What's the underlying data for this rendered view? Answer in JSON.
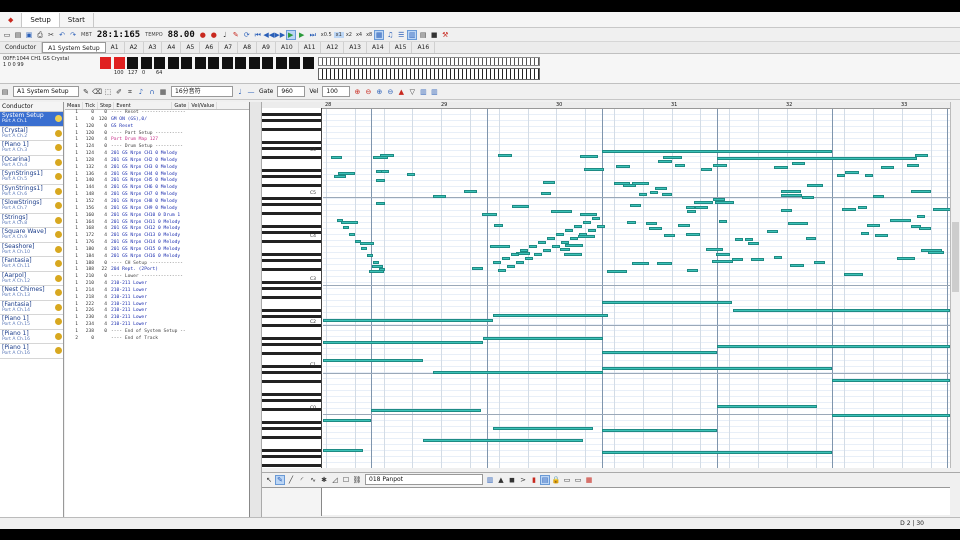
{
  "app_tabs": [
    "Setup",
    "Start"
  ],
  "transport": {
    "position": "28:1:165",
    "tempo": "88.00",
    "pos_caption": "MBT",
    "tempo_caption": "TEMPO"
  },
  "zoom_buttons": [
    "x0.5",
    "x1",
    "x2",
    "x4",
    "x8"
  ],
  "track_tabs": [
    "Conductor",
    "A1 System Setup",
    "A1",
    "A2",
    "A3",
    "A4",
    "A5",
    "A6",
    "A7",
    "A8",
    "A9",
    "A10",
    "A11",
    "A12",
    "A13",
    "A14",
    "A15",
    "A16"
  ],
  "device_info": {
    "line1": "00FF:1044 CH1 GS Crystal",
    "line2": "1    0    0     99"
  },
  "meter": {
    "values": [
      "100",
      "127",
      "0",
      "64"
    ]
  },
  "toolbar2": {
    "track_label": "A1 System Setup",
    "style_combo": "16分音符",
    "gate_label": "Gate",
    "gate_value": "960",
    "vel_label": "Vel",
    "vel_value": "100"
  },
  "tracklist": {
    "header": "Conductor",
    "tracks": [
      {
        "name": "System Setup",
        "sub": "Port A Ch.1"
      },
      {
        "name": "[Crystal]",
        "sub": "Port A Ch.2"
      },
      {
        "name": "[Piano 1]",
        "sub": "Port A Ch.3"
      },
      {
        "name": "[Ocarina]",
        "sub": "Port A Ch.4"
      },
      {
        "name": "[SynStrings1]",
        "sub": "Port A Ch.5"
      },
      {
        "name": "[SynStrings1]",
        "sub": "Port A Ch.6"
      },
      {
        "name": "[SlowStrings]",
        "sub": "Port A Ch.7"
      },
      {
        "name": "[Strings]",
        "sub": "Port A Ch.8"
      },
      {
        "name": "[Square Wave]",
        "sub": "Port A Ch.9"
      },
      {
        "name": "[Seashore]",
        "sub": "Port A Ch.10"
      },
      {
        "name": "[Fantasia]",
        "sub": "Port A Ch.11"
      },
      {
        "name": "[Aarpol]",
        "sub": "Port A Ch.12"
      },
      {
        "name": "[Nest Chimes]",
        "sub": "Port A Ch.13"
      },
      {
        "name": "[Fantasia]",
        "sub": "Port A Ch.14"
      },
      {
        "name": "[Piano 1]",
        "sub": "Port A Ch.15"
      },
      {
        "name": "[Piano 1]",
        "sub": "Port A Ch.16"
      },
      {
        "name": "[Piano 1]",
        "sub": "Port A Ch.16"
      }
    ]
  },
  "eventlist": {
    "columns": [
      "Meas",
      "Tick",
      "Step",
      "Event",
      "Gate",
      "Vel/Value"
    ],
    "rows": [
      {
        "m": "1",
        "t": "0",
        "s": "0",
        "e": "---- Reset ----------------",
        "k": "sep"
      },
      {
        "m": "1",
        "t": "0",
        "s": "120",
        "e": "GM ON (GS),0/",
        "k": ""
      },
      {
        "m": "1",
        "t": "120",
        "s": "0",
        "e": "GS Reset",
        "k": ""
      },
      {
        "m": "1",
        "t": "120",
        "s": "0",
        "e": "---- Part Setup ----------",
        "k": "sep"
      },
      {
        "m": "1",
        "t": "120",
        "s": "4",
        "e": "Part Drum Map          127",
        "k": "pink"
      },
      {
        "m": "1",
        "t": "124",
        "s": "0",
        "e": "---- Drum Setup ----------",
        "k": "sep"
      },
      {
        "m": "1",
        "t": "124",
        "s": "4",
        "e": "201 GS Nrpn CH1 0  Melody",
        "k": ""
      },
      {
        "m": "1",
        "t": "128",
        "s": "4",
        "e": "201 GS Nrpn CH2 0  Melody",
        "k": ""
      },
      {
        "m": "1",
        "t": "132",
        "s": "4",
        "e": "201 GS Nrpn CH3 0  Melody",
        "k": ""
      },
      {
        "m": "1",
        "t": "136",
        "s": "4",
        "e": "201 GS Nrpn CH4 0  Melody",
        "k": ""
      },
      {
        "m": "1",
        "t": "140",
        "s": "4",
        "e": "201 GS Nrpn CH5 0  Melody",
        "k": ""
      },
      {
        "m": "1",
        "t": "144",
        "s": "4",
        "e": "201 GS Nrpn CH6 0  Melody",
        "k": ""
      },
      {
        "m": "1",
        "t": "148",
        "s": "4",
        "e": "201 GS Nrpn CH7 0  Melody",
        "k": ""
      },
      {
        "m": "1",
        "t": "152",
        "s": "4",
        "e": "201 GS Nrpn CH8 0  Melody",
        "k": ""
      },
      {
        "m": "1",
        "t": "156",
        "s": "4",
        "e": "201 GS Nrpn CH9 0  Melody",
        "k": ""
      },
      {
        "m": "1",
        "t": "160",
        "s": "4",
        "e": "201 GS Nrpn CH10 0 Drum 1",
        "k": ""
      },
      {
        "m": "1",
        "t": "164",
        "s": "4",
        "e": "201 GS Nrpn CH11 0 Melody",
        "k": ""
      },
      {
        "m": "1",
        "t": "168",
        "s": "4",
        "e": "201 GS Nrpn CH12 0 Melody",
        "k": ""
      },
      {
        "m": "1",
        "t": "172",
        "s": "4",
        "e": "201 GS Nrpn CH13 0 Melody",
        "k": ""
      },
      {
        "m": "1",
        "t": "176",
        "s": "4",
        "e": "201 GS Nrpn CH14 0 Melody",
        "k": ""
      },
      {
        "m": "1",
        "t": "180",
        "s": "4",
        "e": "201 GS Nrpn CH15 0 Melody",
        "k": ""
      },
      {
        "m": "1",
        "t": "184",
        "s": "4",
        "e": "201 GS Nrpn CH16 0 Melody",
        "k": ""
      },
      {
        "m": "1",
        "t": "188",
        "s": "0",
        "e": "---- CH Setup ------------",
        "k": "sep"
      },
      {
        "m": "1",
        "t": "188",
        "s": "22",
        "e": "204 Rept. (2Port)",
        "k": ""
      },
      {
        "m": "1",
        "t": "210",
        "s": "0",
        "e": "---- Lower ---------------",
        "k": "sep"
      },
      {
        "m": "1",
        "t": "210",
        "s": "4",
        "e": "210-211 Lower",
        "k": ""
      },
      {
        "m": "1",
        "t": "214",
        "s": "4",
        "e": "210-211 Lower",
        "k": ""
      },
      {
        "m": "1",
        "t": "218",
        "s": "4",
        "e": "210-211 Lower",
        "k": ""
      },
      {
        "m": "1",
        "t": "222",
        "s": "4",
        "e": "210-211 Lower",
        "k": ""
      },
      {
        "m": "1",
        "t": "226",
        "s": "4",
        "e": "210-211 Lower",
        "k": ""
      },
      {
        "m": "1",
        "t": "230",
        "s": "4",
        "e": "210-211 Lower",
        "k": ""
      },
      {
        "m": "1",
        "t": "234",
        "s": "4",
        "e": "210-211 Lower",
        "k": ""
      },
      {
        "m": "1",
        "t": "238",
        "s": "0",
        "e": "---- End of System Setup --",
        "k": "sep"
      },
      {
        "m": "2",
        "t": "0",
        "s": "",
        "e": "---- End of Track",
        "k": "sep"
      }
    ]
  },
  "roll": {
    "measures": [
      "28",
      "29",
      "30",
      "31",
      "32",
      "33"
    ],
    "octaves": [
      "C6",
      "C5",
      "C4",
      "C3",
      "C2",
      "C1",
      "C0"
    ]
  },
  "lower": {
    "event_combo": "018 Panpot"
  },
  "status": {
    "text": "D 2 | 30"
  },
  "colors": {
    "note": "#3cc2b8",
    "note_border": "#1e8b84",
    "accent": "#3a6fd0"
  }
}
